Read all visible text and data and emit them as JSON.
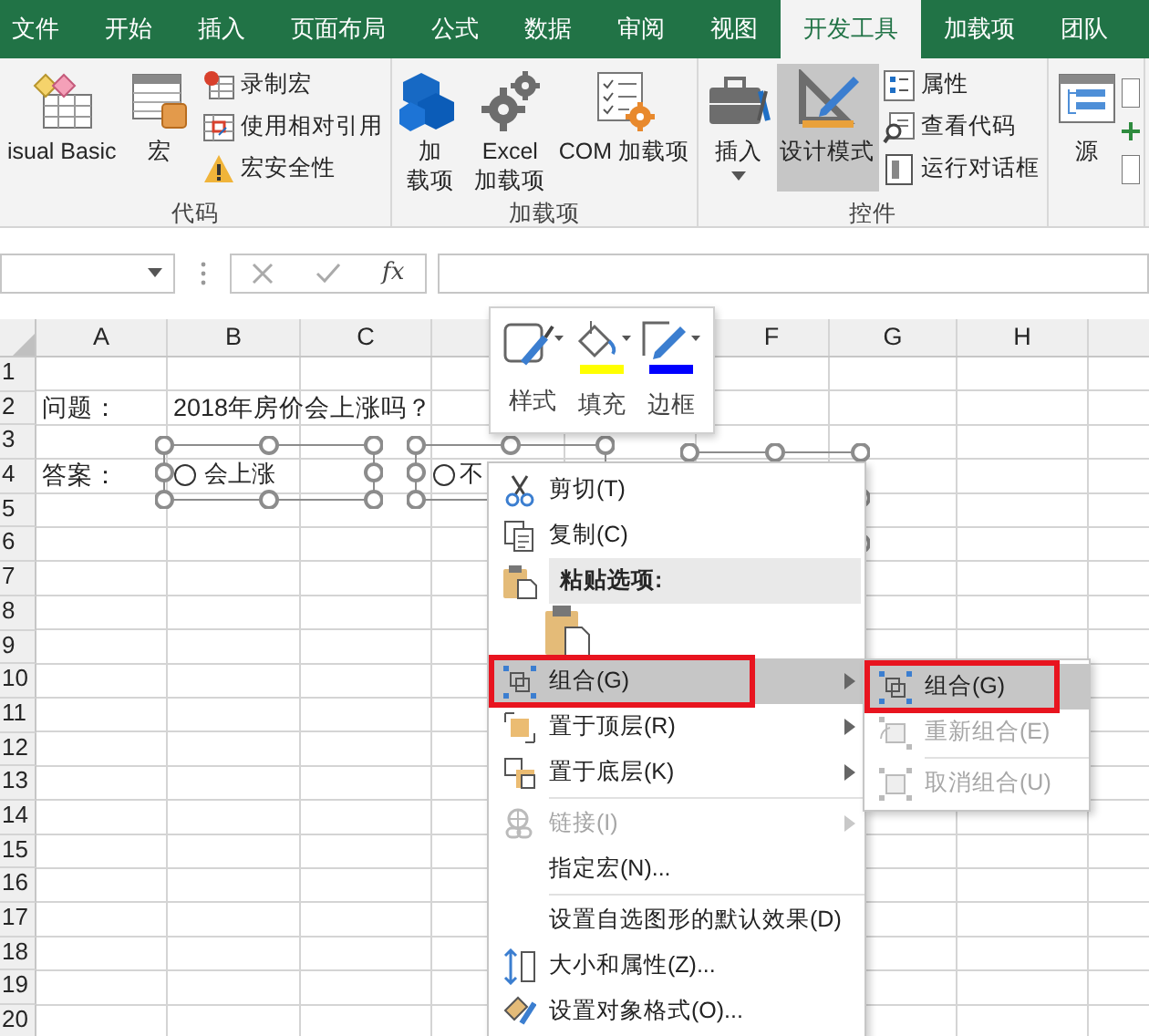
{
  "ribbon_tabs": [
    {
      "label": "文件",
      "selected": false
    },
    {
      "label": "开始",
      "selected": false
    },
    {
      "label": "插入",
      "selected": false
    },
    {
      "label": "页面布局",
      "selected": false
    },
    {
      "label": "公式",
      "selected": false
    },
    {
      "label": "数据",
      "selected": false
    },
    {
      "label": "审阅",
      "selected": false
    },
    {
      "label": "视图",
      "selected": false
    },
    {
      "label": "开发工具",
      "selected": true
    },
    {
      "label": "加载项",
      "selected": false
    },
    {
      "label": "团队",
      "selected": false
    }
  ],
  "ribbon": {
    "groups": [
      {
        "label": "代码",
        "large": [
          {
            "lines": [
              "isual Basic"
            ],
            "pressed": false,
            "dropdown": false
          },
          {
            "lines": [
              "宏"
            ],
            "pressed": false,
            "dropdown": false
          }
        ],
        "small": [
          {
            "label": "录制宏"
          },
          {
            "label": "使用相对引用"
          },
          {
            "label": "宏安全性"
          }
        ]
      },
      {
        "label": "加载项",
        "large": [
          {
            "lines": [
              "加",
              "载项"
            ],
            "pressed": false,
            "dropdown": false
          },
          {
            "lines": [
              "Excel",
              "加载项"
            ],
            "pressed": false,
            "dropdown": false
          },
          {
            "lines": [
              "COM 加载项"
            ],
            "pressed": false,
            "dropdown": false
          }
        ]
      },
      {
        "label": "控件",
        "large": [
          {
            "lines": [
              "插入"
            ],
            "pressed": false,
            "dropdown": true
          },
          {
            "lines": [
              "设计模式"
            ],
            "pressed": true,
            "dropdown": false
          }
        ],
        "small": [
          {
            "label": "属性"
          },
          {
            "label": "查看代码"
          },
          {
            "label": "运行对话框"
          }
        ]
      },
      {
        "large": [
          {
            "lines": [
              "源"
            ],
            "pressed": false,
            "dropdown": false
          }
        ]
      }
    ]
  },
  "formula_bar": {
    "function_button": "fx"
  },
  "sheet": {
    "columns": [
      "A",
      "B",
      "C",
      null,
      "F",
      "G",
      "H"
    ],
    "rows": [
      {
        "header": "1",
        "cells": []
      },
      {
        "header": "2",
        "cells": [
          {
            "text": "问题："
          },
          {
            "text": "2018年房价会上涨吗？"
          }
        ]
      },
      {
        "header": "3",
        "cells": []
      },
      {
        "header": "4",
        "cells": [
          {
            "text": "答案："
          }
        ]
      },
      {
        "header": "5",
        "cells": []
      },
      {
        "header": "6",
        "cells": []
      },
      {
        "header": "7",
        "cells": []
      },
      {
        "header": "8",
        "cells": []
      },
      {
        "header": "9",
        "cells": []
      },
      {
        "header": "10",
        "cells": []
      },
      {
        "header": "11",
        "cells": []
      },
      {
        "header": "12",
        "cells": []
      },
      {
        "header": "13",
        "cells": []
      },
      {
        "header": "14",
        "cells": []
      },
      {
        "header": "15",
        "cells": []
      },
      {
        "header": "16",
        "cells": []
      },
      {
        "header": "17",
        "cells": []
      },
      {
        "header": "18",
        "cells": []
      },
      {
        "header": "19",
        "cells": []
      },
      {
        "header": "20",
        "cells": []
      }
    ],
    "shapes": [
      {
        "kind": "option-button",
        "label": "会上涨",
        "selected": false
      },
      {
        "kind": "option-button",
        "label": "不",
        "selected": false
      },
      {
        "kind": "frame"
      }
    ]
  },
  "mini_toolbar": {
    "buttons": [
      {
        "label": "样式"
      },
      {
        "label": "填充",
        "color": "#ffff00"
      },
      {
        "label": "边框",
        "color": "#0000ff"
      }
    ]
  },
  "context_menu": {
    "items": [
      {
        "kind": "item",
        "label": "剪切(T)",
        "selected": false,
        "disabled": false,
        "submenu": false,
        "annotated": false
      },
      {
        "kind": "item",
        "label": "复制(C)",
        "selected": false,
        "disabled": false,
        "submenu": false,
        "annotated": false
      },
      {
        "kind": "header",
        "label": "粘贴选项:"
      },
      {
        "kind": "paste-options"
      },
      {
        "kind": "item",
        "label": "组合(G)",
        "selected": true,
        "disabled": false,
        "submenu": true,
        "annotated": true
      },
      {
        "kind": "item",
        "label": "置于顶层(R)",
        "selected": false,
        "disabled": false,
        "submenu": true,
        "annotated": false
      },
      {
        "kind": "item",
        "label": "置于底层(K)",
        "selected": false,
        "disabled": false,
        "submenu": true,
        "annotated": false
      },
      {
        "kind": "separator"
      },
      {
        "kind": "item",
        "label": "链接(I)",
        "selected": false,
        "disabled": true,
        "submenu": true,
        "annotated": false
      },
      {
        "kind": "item",
        "label": "指定宏(N)...",
        "selected": false,
        "disabled": false,
        "submenu": false,
        "annotated": false
      },
      {
        "kind": "separator"
      },
      {
        "kind": "item",
        "label": "设置自选图形的默认效果(D)",
        "selected": false,
        "disabled": false,
        "submenu": false,
        "annotated": false
      },
      {
        "kind": "item",
        "label": "大小和属性(Z)...",
        "selected": false,
        "disabled": false,
        "submenu": false,
        "annotated": false
      },
      {
        "kind": "item",
        "label": "设置对象格式(O)...",
        "selected": false,
        "disabled": false,
        "submenu": false,
        "annotated": false
      }
    ]
  },
  "submenu": {
    "items": [
      {
        "kind": "item",
        "label": "组合(G)",
        "selected": true,
        "disabled": false,
        "annotated": true
      },
      {
        "kind": "item",
        "label": "重新组合(E)",
        "selected": false,
        "disabled": true,
        "annotated": false
      },
      {
        "kind": "separator"
      },
      {
        "kind": "item",
        "label": "取消组合(U)",
        "selected": false,
        "disabled": true,
        "annotated": false
      }
    ]
  }
}
